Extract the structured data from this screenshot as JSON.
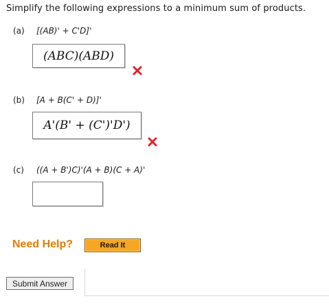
{
  "question": {
    "title": "Simplify the following expressions to a minimum sum of products."
  },
  "parts": [
    {
      "label": "(a)",
      "expression": "[(AB)' + C'D]'",
      "answer": "(ABC)(ABD)",
      "status_icon": "x-icon",
      "status_color": "#e0212b"
    },
    {
      "label": "(b)",
      "expression": "[A + B(C' + D)]'",
      "answer": "A'(B' + (C')'D')",
      "status_icon": "x-icon",
      "status_color": "#e0212b"
    },
    {
      "label": "(c)",
      "expression": "((A + B')C)'(A + B)(C + A)'",
      "answer": ""
    }
  ],
  "help": {
    "label": "Need Help?",
    "read_it_label": "Read It"
  },
  "submit": {
    "label": "Submit Answer"
  }
}
